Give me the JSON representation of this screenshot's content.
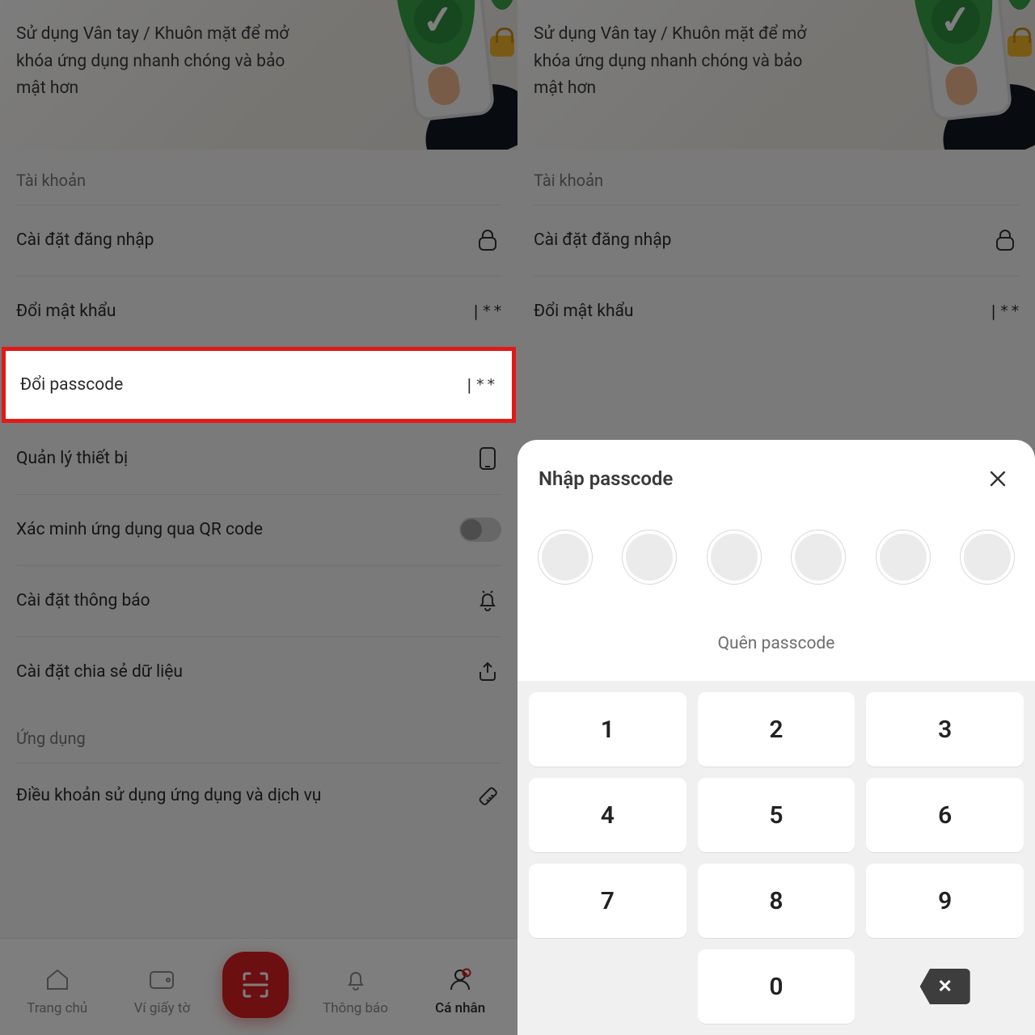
{
  "banner": {
    "text": "Sử dụng Vân tay / Khuôn mặt để mở  khóa ứng dụng nhanh chóng và bảo mật hơn"
  },
  "sections": {
    "account_title": "Tài khoản",
    "login_settings": "Cài đặt đăng nhập",
    "change_password": "Đổi mật khẩu",
    "change_passcode": "Đổi passcode",
    "device_mgmt": "Quản lý thiết bị",
    "qr_verify": "Xác minh ứng dụng qua QR code",
    "notify_settings": "Cài đặt thông báo",
    "share_settings": "Cài đặt chia sẻ dữ liệu",
    "app_title": "Ứng dụng",
    "terms": "Điều khoản sử dụng ứng dụng và dịch vụ",
    "pw_mask": "|**"
  },
  "nav": {
    "home": "Trang chủ",
    "wallet": "Ví giấy tờ",
    "notify": "Thông báo",
    "profile": "Cá nhân"
  },
  "passcode_sheet": {
    "title": "Nhập passcode",
    "forgot": "Quên passcode",
    "keys": [
      "1",
      "2",
      "3",
      "4",
      "5",
      "6",
      "7",
      "8",
      "9",
      "",
      "0",
      "⌫"
    ]
  }
}
